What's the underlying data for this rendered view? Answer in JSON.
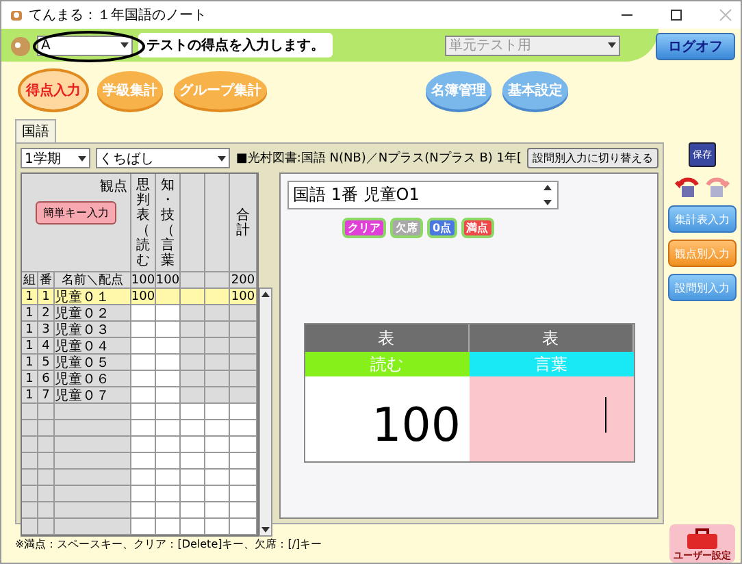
{
  "window": {
    "title": "てんまる：１年国語のノート"
  },
  "header": {
    "class_select": "A",
    "instruction": "テストの得点を入力します。",
    "test_type_select": {
      "value": "単元テスト用",
      "disabled": true
    },
    "logoff_button": "ログオフ"
  },
  "nav_buttons": [
    {
      "label": "得点入力",
      "kind": "orange",
      "selected": true
    },
    {
      "label": "学級集計",
      "kind": "orange",
      "selected": false
    },
    {
      "label": "グループ集計",
      "kind": "orange",
      "selected": false
    },
    {
      "label": "名簿管理",
      "kind": "blue",
      "selected": false
    },
    {
      "label": "基本設定",
      "kind": "blue",
      "selected": false
    }
  ],
  "subject_tabs": [
    {
      "label": "国語",
      "selected": true
    }
  ],
  "toolbar": {
    "term_select": "1学期",
    "unit_select": "くちばし",
    "textbook_info": "■光村図書:国語 N(NB)／Nプラス(Nプラス B) 1年[",
    "switch_button": "設問別入力に切り替える"
  },
  "grid": {
    "viewpoint_label": "観点",
    "easy_key_button": "簡単キー入力",
    "class_header": "組",
    "number_header": "番",
    "name_header": "名前＼配点",
    "columns": [
      {
        "header": "思判表（読む",
        "max": "100"
      },
      {
        "header": "知・技（言葉",
        "max": "100"
      },
      {
        "kind": "empty"
      },
      {
        "kind": "empty"
      }
    ],
    "total_column": {
      "header": "合計",
      "max": "200"
    },
    "rows": [
      {
        "class": "1",
        "number": "1",
        "name": "児童０１",
        "scores": [
          "100"
        ],
        "total": "100",
        "selected": true
      },
      {
        "class": "1",
        "number": "2",
        "name": "児童０２",
        "selected": false
      },
      {
        "class": "1",
        "number": "3",
        "name": "児童０３",
        "selected": false
      },
      {
        "class": "1",
        "number": "4",
        "name": "児童０４",
        "selected": false
      },
      {
        "class": "1",
        "number": "5",
        "name": "児童０５",
        "selected": false
      },
      {
        "class": "1",
        "number": "6",
        "name": "児童０６",
        "selected": false
      },
      {
        "class": "1",
        "number": "7",
        "name": "児童０７",
        "selected": false
      }
    ]
  },
  "entry": {
    "student_field": "国語 1番 児童O1",
    "quick_buttons": [
      {
        "label": "クリア",
        "color": "#e040d8"
      },
      {
        "label": "欠席",
        "color": "#a8a8a8"
      },
      {
        "label": "0点",
        "color": "#4a78e0"
      },
      {
        "label": "満点",
        "color": "#f04848"
      }
    ],
    "score_table": [
      {
        "group": "表",
        "label": "読む",
        "kind": "green",
        "value": "100",
        "editing": false
      },
      {
        "group": "表",
        "label": "言葉",
        "kind": "cyan",
        "editing": true
      }
    ]
  },
  "sidebar": {
    "save_button": "保存",
    "mode_buttons": [
      {
        "label": "集計表入力",
        "selected": false
      },
      {
        "label": "観点別入力",
        "selected": true
      },
      {
        "label": "設問別入力",
        "selected": false
      }
    ],
    "user_settings_button": "ユーザー設定"
  },
  "status_hint": "※満点：スペースキー、クリア：[Delete]キー、欠席：[/]キー"
}
